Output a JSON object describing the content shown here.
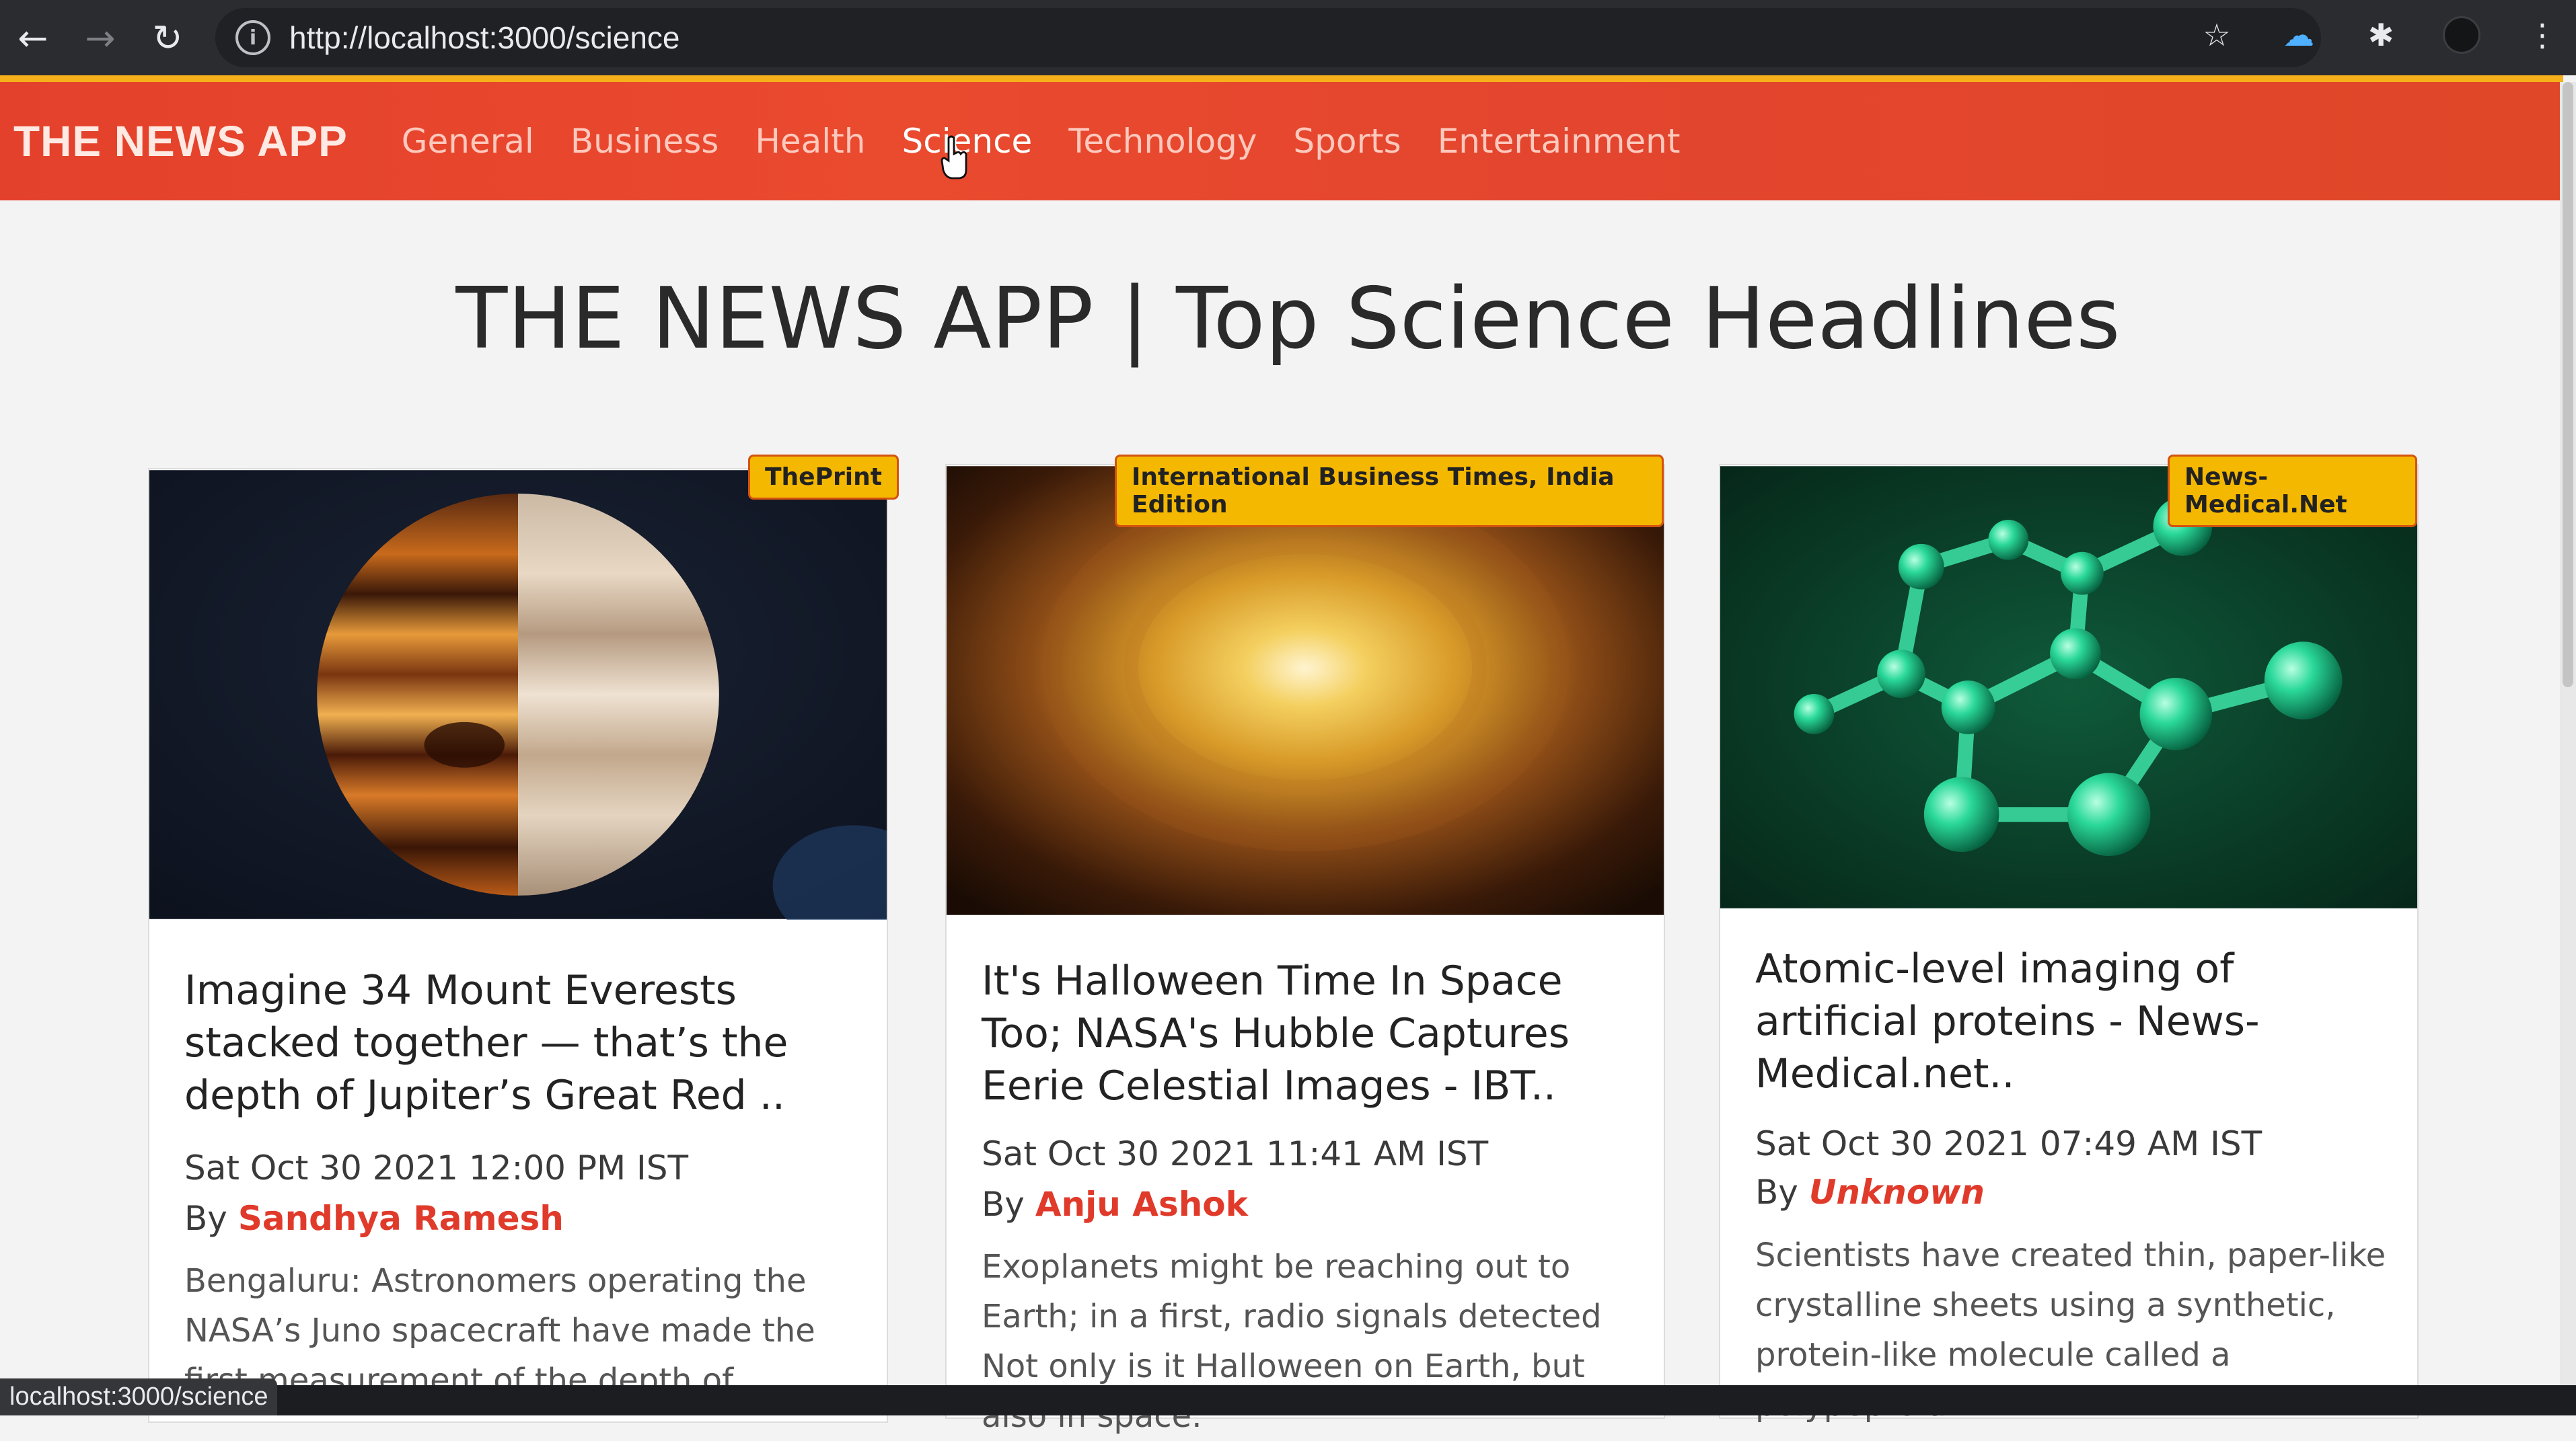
{
  "browser": {
    "url": "http://localhost:3000/science",
    "back_icon": "arrow-left",
    "forward_icon": "arrow-right",
    "reload_icon": "reload",
    "status_url": "localhost:3000/science"
  },
  "navbar": {
    "brand": "THE NEWS APP",
    "links": [
      {
        "label": "General",
        "active": false
      },
      {
        "label": "Business",
        "active": false
      },
      {
        "label": "Health",
        "active": false
      },
      {
        "label": "Science",
        "active": true
      },
      {
        "label": "Technology",
        "active": false
      },
      {
        "label": "Sports",
        "active": false
      },
      {
        "label": "Entertainment",
        "active": false
      }
    ]
  },
  "page": {
    "title": "THE NEWS APP | Top Science Headlines"
  },
  "cards": [
    {
      "source": "ThePrint",
      "title": "Imagine 34 Mount Everests stacked together — that’s the depth of Jupiter’s Great Red ..",
      "date": "Sat Oct 30 2021 12:00 PM IST",
      "by_label": "By",
      "author": "Sandhya Ramesh",
      "description": "Bengaluru: Astronomers operating the NASA’s Juno spacecraft have made the first measurement of the depth of"
    },
    {
      "source": "International Business Times, India Edition",
      "title": "It's Halloween Time In Space Too; NASA's Hubble Captures Eerie Celestial Images - IBT..",
      "date": "Sat Oct 30 2021 11:41 AM IST",
      "by_label": "By",
      "author": "Anju Ashok",
      "description": "Exoplanets might be reaching out to Earth; in a first, radio signals detected Not only is it Halloween on Earth, but also in space."
    },
    {
      "source": "News-Medical.Net",
      "title": "Atomic-level imaging of artificial proteins - News-Medical.net..",
      "date": "Sat Oct 30 2021 07:49 AM IST",
      "by_label": "By",
      "author": "Unknown",
      "description": "Scientists have created thin, paper-like crystalline sheets using a synthetic, protein-like molecule called a polypeptoid."
    }
  ],
  "colors": {
    "navbar": "#e4412c",
    "accent": "#f5b01a",
    "badge": "#f5b800",
    "author": "#e03a2b"
  }
}
